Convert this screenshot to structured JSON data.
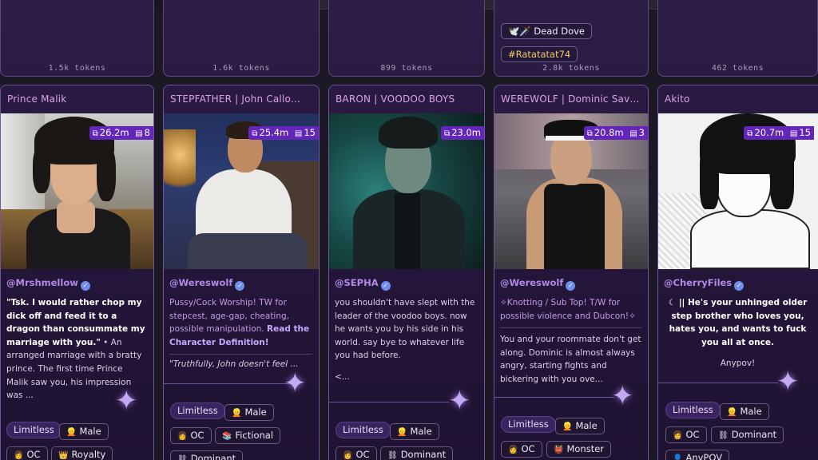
{
  "header": {},
  "previous_row": [
    {
      "tokens": "1.5k tokens",
      "tags": []
    },
    {
      "tokens": "1.6k tokens",
      "tags": []
    },
    {
      "tokens": "899 tokens",
      "tags": []
    },
    {
      "tokens": "2.8k tokens",
      "tags": [
        "🕊️🗡️ Dead Dove",
        "#Ratatatat74"
      ]
    },
    {
      "tokens": "462 tokens",
      "tags": []
    }
  ],
  "cards": [
    {
      "title": "Prince Malik",
      "chats": "26.2m",
      "files": "8",
      "creator": "@Mrshmellow",
      "desc_bold": "\"Tsk. I would rather chop my dick off and feed it to a dragon than consummate my marriage with you.\"",
      "desc_rest": " • An arranged marriage with a bratty prince. The first time Prince Malik saw you, his impression was ...",
      "tags": [
        "Limitless",
        "Male",
        "OC",
        "Royalty"
      ]
    },
    {
      "title": "STEPFATHER | John Callo...",
      "chats": "25.4m",
      "files": "15",
      "creator": "@Wereswolf",
      "desc_plain": "Pussy/Cock Worship! TW for stepcest, age-gap, cheating, possible manipulation. ",
      "desc_bold": "Read the Character Definition!",
      "quote": "\"Truthfully, John doesn't feel ...",
      "tags": [
        "Limitless",
        "Male",
        "OC",
        "Fictional",
        "Dominant"
      ]
    },
    {
      "title": "BARON | VOODOO BOYS",
      "chats": "23.0m",
      "files": "",
      "creator": "@SEPHA",
      "desc_plain": "you shouldn't have slept with the leader of the voodoo boys. now he wants you by his side in his world. say bye to whatever life you had before.",
      "desc_end": "<...",
      "tags": [
        "Limitless",
        "Male",
        "OC",
        "Dominant"
      ]
    },
    {
      "title": "WEREWOLF | Dominic Savi...",
      "chats": "20.8m",
      "files": "3",
      "creator": "@Wereswolf",
      "desc_violet": "✧Knotting / Sub Top! T/W for possible violence and Dubcon!✧",
      "desc_plain": "You and your roommate don't get along. Dominic is almost always angry, starting fights and bickering with you ove...",
      "tags": [
        "Limitless",
        "Male",
        "OC",
        "Monster"
      ]
    },
    {
      "title": "Akito",
      "chats": "20.7m",
      "files": "15",
      "creator": "@CherryFiles",
      "desc_bold": "☾ || He's your unhinged older step brother who loves you, hates you, and wants to fuck you all at once.",
      "desc_plain": "Anypov!",
      "tags": [
        "Limitless",
        "Male",
        "OC",
        "Dominant",
        "AnyPOV"
      ]
    }
  ],
  "icons": {
    "chat": "chat-bubbles-icon",
    "file": "file-icon",
    "verified": "verified-badge-icon",
    "male": "male-emoji-icon",
    "oc": "person-emoji-icon",
    "royalty": "crown-icon",
    "fictional": "book-icon",
    "dominant": "chains-icon",
    "monster": "monster-icon",
    "anypov": "person-icon"
  },
  "colors": {
    "accent": "#6326b8",
    "card_border": "#6d55a0",
    "title": "#d9a3e8",
    "creator": "#b28ae6"
  }
}
